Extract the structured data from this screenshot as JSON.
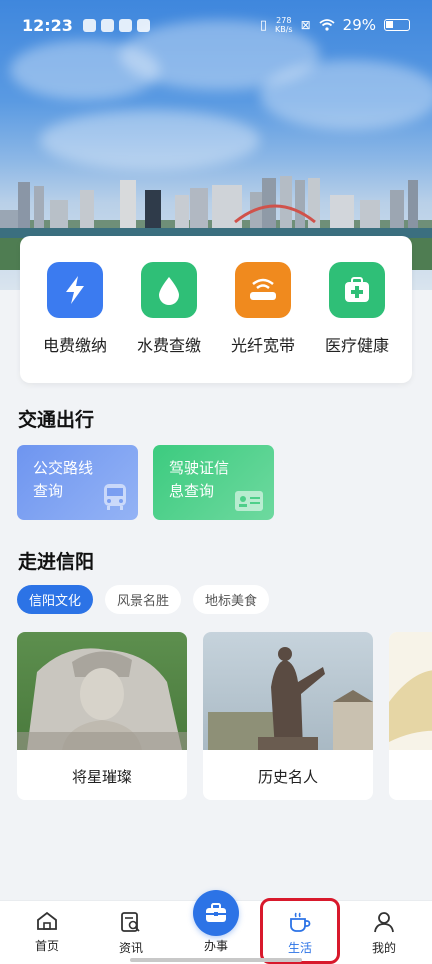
{
  "status_bar": {
    "time": "12:23",
    "net_speed_value": "278",
    "net_speed_unit": "KB/s",
    "battery": "29%"
  },
  "services": [
    {
      "label": "电费缴纳",
      "icon": "lightning-icon",
      "color": "#3b7bf0"
    },
    {
      "label": "水费查缴",
      "icon": "water-drop-icon",
      "color": "#2fbf77"
    },
    {
      "label": "光纤宽带",
      "icon": "router-icon",
      "color": "#f08a1e"
    },
    {
      "label": "医疗健康",
      "icon": "medical-kit-icon",
      "color": "#2fbf77"
    }
  ],
  "transport": {
    "title": "交通出行",
    "cards": [
      {
        "label": "公交路线查询",
        "line1": "公交路线",
        "line2": "查询",
        "icon": "bus-icon",
        "color": "#6e95f0"
      },
      {
        "label": "驾驶证信息查询",
        "line1": "驾驶证信",
        "line2": "息查询",
        "icon": "id-card-icon",
        "color": "#3ccb7f"
      }
    ]
  },
  "discover": {
    "title": "走进信阳",
    "chips": [
      {
        "label": "信阳文化",
        "active": true
      },
      {
        "label": "风景名胜",
        "active": false
      },
      {
        "label": "地标美食",
        "active": false
      }
    ],
    "cards": [
      {
        "caption": "将星璀璨"
      },
      {
        "caption": "历史名人"
      }
    ]
  },
  "bottom_nav": {
    "items": [
      {
        "label": "首页",
        "icon": "home-icon"
      },
      {
        "label": "资讯",
        "icon": "news-search-icon"
      },
      {
        "label": "办事",
        "icon": "briefcase-icon"
      },
      {
        "label": "生活",
        "icon": "coffee-cup-icon",
        "active": true
      },
      {
        "label": "我的",
        "icon": "person-icon"
      }
    ]
  },
  "colors": {
    "accent": "#2c73e6",
    "highlight": "#d8192c"
  }
}
